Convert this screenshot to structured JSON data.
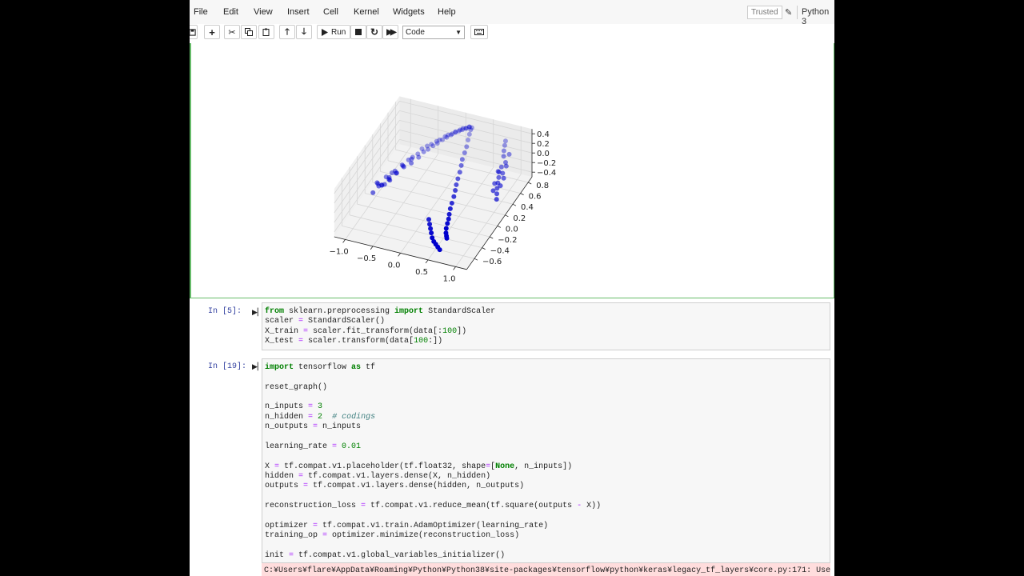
{
  "menubar": {
    "items": [
      "File",
      "Edit",
      "View",
      "Insert",
      "Cell",
      "Kernel",
      "Widgets",
      "Help"
    ],
    "trusted": "Trusted",
    "kernel": "Python 3"
  },
  "toolbar": {
    "run_label": "Run",
    "cell_type": "Code",
    "icons": [
      "save-icon",
      "add-cell-icon",
      "cut-icon",
      "copy-icon",
      "paste-icon",
      "move-up-icon",
      "move-down-icon",
      "run-icon",
      "stop-icon",
      "restart-icon",
      "fast-forward-icon",
      "keyboard-icon"
    ]
  },
  "chart_data": {
    "type": "scatter",
    "projection": "3d",
    "title": "",
    "x_ticks": [
      "−1.0",
      "−0.5",
      "0.0",
      "0.5",
      "1.0"
    ],
    "y_ticks": [
      "−0.6",
      "−0.4",
      "−0.2",
      "0.0",
      "0.2",
      "0.4",
      "0.6",
      "0.8"
    ],
    "z_ticks": [
      "−0.4",
      "−0.2",
      "0.0",
      "0.2",
      "0.4"
    ],
    "xlim": [
      -1.2,
      1.2
    ],
    "ylim": [
      -0.7,
      0.9
    ],
    "zlim": [
      -0.5,
      0.5
    ],
    "color": "#0000cc",
    "grid": true,
    "points": [
      [
        -1.05,
        0.1,
        -0.35
      ],
      [
        -1.0,
        0.05,
        -0.3
      ],
      [
        -0.98,
        0.12,
        -0.4
      ],
      [
        -0.95,
        0.0,
        -0.28
      ],
      [
        -1.02,
        -0.05,
        -0.38
      ],
      [
        -0.92,
        0.15,
        -0.25
      ],
      [
        -0.9,
        0.08,
        -0.32
      ],
      [
        -0.88,
        -0.02,
        -0.22
      ],
      [
        -0.85,
        0.2,
        -0.2
      ],
      [
        -0.83,
        0.1,
        -0.18
      ],
      [
        -0.8,
        0.05,
        -0.15
      ],
      [
        -0.78,
        0.18,
        -0.12
      ],
      [
        -0.75,
        0.0,
        -0.1
      ],
      [
        -0.72,
        0.12,
        -0.08
      ],
      [
        -0.7,
        0.25,
        -0.05
      ],
      [
        -0.68,
        0.08,
        -0.02
      ],
      [
        -0.65,
        0.2,
        0.0
      ],
      [
        -0.62,
        0.3,
        0.02
      ],
      [
        -0.6,
        0.15,
        0.05
      ],
      [
        -0.58,
        0.35,
        0.03
      ],
      [
        -0.55,
        0.28,
        0.08
      ],
      [
        -0.52,
        0.4,
        0.06
      ],
      [
        -0.5,
        0.2,
        0.1
      ],
      [
        -0.48,
        0.45,
        0.12
      ],
      [
        -0.45,
        0.32,
        0.1
      ],
      [
        -0.42,
        0.5,
        0.14
      ],
      [
        -0.4,
        0.38,
        0.16
      ],
      [
        -0.38,
        0.55,
        0.13
      ],
      [
        -0.35,
        0.42,
        0.18
      ],
      [
        -0.32,
        0.6,
        0.15
      ],
      [
        -0.3,
        0.48,
        0.2
      ],
      [
        -0.28,
        0.62,
        0.17
      ],
      [
        -0.25,
        0.52,
        0.22
      ],
      [
        -0.22,
        0.68,
        0.19
      ],
      [
        -0.2,
        0.58,
        0.24
      ],
      [
        -0.18,
        0.7,
        0.21
      ],
      [
        -0.15,
        0.62,
        0.26
      ],
      [
        -0.12,
        0.72,
        0.23
      ],
      [
        -0.1,
        0.66,
        0.28
      ],
      [
        -0.08,
        0.75,
        0.25
      ],
      [
        -0.05,
        0.7,
        0.3
      ],
      [
        -0.02,
        0.78,
        0.27
      ],
      [
        0.0,
        0.72,
        0.32
      ],
      [
        0.02,
        0.8,
        0.29
      ],
      [
        0.05,
        0.74,
        0.34
      ],
      [
        0.08,
        0.8,
        0.31
      ],
      [
        0.1,
        0.76,
        0.36
      ],
      [
        0.12,
        0.82,
        0.33
      ],
      [
        0.15,
        0.78,
        0.38
      ],
      [
        0.18,
        0.8,
        0.35
      ],
      [
        0.2,
        0.74,
        0.38
      ],
      [
        0.22,
        0.68,
        0.36
      ],
      [
        0.25,
        0.6,
        0.34
      ],
      [
        0.28,
        0.52,
        0.3
      ],
      [
        0.3,
        0.44,
        0.27
      ],
      [
        0.32,
        0.35,
        0.24
      ],
      [
        0.35,
        0.28,
        0.2
      ],
      [
        0.38,
        0.2,
        0.16
      ],
      [
        0.4,
        0.12,
        0.12
      ],
      [
        0.42,
        0.05,
        0.08
      ],
      [
        0.45,
        -0.02,
        0.05
      ],
      [
        0.48,
        -0.1,
        0.02
      ],
      [
        0.5,
        -0.18,
        -0.02
      ],
      [
        0.52,
        -0.25,
        -0.05
      ],
      [
        0.55,
        -0.32,
        -0.08
      ],
      [
        0.58,
        -0.38,
        -0.1
      ],
      [
        0.6,
        -0.44,
        -0.12
      ],
      [
        0.62,
        -0.5,
        -0.15
      ],
      [
        0.65,
        -0.55,
        -0.18
      ],
      [
        0.68,
        -0.58,
        -0.2
      ],
      [
        0.7,
        -0.6,
        -0.22
      ],
      [
        0.3,
        -0.45,
        -0.3
      ],
      [
        0.35,
        -0.5,
        -0.32
      ],
      [
        0.4,
        -0.55,
        -0.35
      ],
      [
        0.45,
        -0.58,
        -0.38
      ],
      [
        0.5,
        -0.6,
        -0.4
      ],
      [
        0.25,
        -0.4,
        -0.28
      ],
      [
        0.2,
        -0.35,
        -0.25
      ],
      [
        0.55,
        -0.62,
        -0.42
      ],
      [
        0.6,
        -0.64,
        -0.44
      ],
      [
        0.95,
        0.4,
        0.1
      ],
      [
        0.98,
        0.35,
        0.05
      ],
      [
        1.0,
        0.3,
        0.0
      ],
      [
        1.02,
        0.25,
        -0.05
      ],
      [
        0.96,
        0.45,
        0.15
      ],
      [
        1.05,
        0.2,
        -0.1
      ],
      [
        1.0,
        0.5,
        0.2
      ],
      [
        0.93,
        0.55,
        0.25
      ],
      [
        1.03,
        0.38,
        0.12
      ],
      [
        1.06,
        0.28,
        -0.02
      ],
      [
        0.9,
        0.6,
        0.3
      ],
      [
        0.88,
        0.65,
        0.35
      ],
      [
        1.08,
        0.15,
        -0.15
      ],
      [
        0.92,
        0.42,
        0.08
      ],
      [
        1.04,
        0.46,
        0.18
      ],
      [
        0.97,
        0.22,
        -0.08
      ],
      [
        1.01,
        0.58,
        0.28
      ],
      [
        0.86,
        0.7,
        0.38
      ],
      [
        1.07,
        0.35,
        0.06
      ],
      [
        0.94,
        0.3,
        -0.03
      ]
    ]
  },
  "cells": [
    {
      "prompt": "In [5]:",
      "lines": [
        [
          [
            "kw",
            "from"
          ],
          [
            "",
            " sklearn.preprocessing "
          ],
          [
            "kw",
            "import"
          ],
          [
            "",
            " StandardScaler"
          ]
        ],
        [
          [
            "",
            "scaler "
          ],
          [
            "op",
            "="
          ],
          [
            "",
            " StandardScaler()"
          ]
        ],
        [
          [
            "",
            "X_train "
          ],
          [
            "op",
            "="
          ],
          [
            "",
            " scaler.fit_transform(data[:"
          ],
          [
            "num",
            "100"
          ],
          [
            "",
            "])"
          ]
        ],
        [
          [
            "",
            "X_test "
          ],
          [
            "op",
            "="
          ],
          [
            "",
            " scaler.transform(data["
          ],
          [
            "num",
            "100"
          ],
          [
            "",
            ":])"
          ]
        ]
      ]
    },
    {
      "prompt": "In [19]:",
      "lines": [
        [
          [
            "kw",
            "import"
          ],
          [
            "",
            " tensorflow "
          ],
          [
            "kw",
            "as"
          ],
          [
            "",
            " tf"
          ]
        ],
        [],
        [
          [
            "",
            "reset_graph()"
          ]
        ],
        [],
        [
          [
            "",
            "n_inputs "
          ],
          [
            "op",
            "="
          ],
          [
            "",
            " "
          ],
          [
            "num",
            "3"
          ]
        ],
        [
          [
            "",
            "n_hidden "
          ],
          [
            "op",
            "="
          ],
          [
            "",
            " "
          ],
          [
            "num",
            "2"
          ],
          [
            "",
            "  "
          ],
          [
            "cm",
            "# codings"
          ]
        ],
        [
          [
            "",
            "n_outputs "
          ],
          [
            "op",
            "="
          ],
          [
            "",
            " n_inputs"
          ]
        ],
        [],
        [
          [
            "",
            "learning_rate "
          ],
          [
            "op",
            "="
          ],
          [
            "",
            " "
          ],
          [
            "num",
            "0.01"
          ]
        ],
        [],
        [
          [
            "",
            "X "
          ],
          [
            "op",
            "="
          ],
          [
            "",
            " tf.compat.v1.placeholder(tf.float32, shape"
          ],
          [
            "op",
            "="
          ],
          [
            "",
            "["
          ],
          [
            "bc",
            "None"
          ],
          [
            "",
            ", n_inputs])"
          ]
        ],
        [
          [
            "",
            "hidden "
          ],
          [
            "op",
            "="
          ],
          [
            "",
            " tf.compat.v1.layers.dense(X, n_hidden)"
          ]
        ],
        [
          [
            "",
            "outputs "
          ],
          [
            "op",
            "="
          ],
          [
            "",
            " tf.compat.v1.layers.dense(hidden, n_outputs)"
          ]
        ],
        [],
        [
          [
            "",
            "reconstruction_loss "
          ],
          [
            "op",
            "="
          ],
          [
            "",
            " tf.compat.v1.reduce_mean(tf.square(outputs "
          ],
          [
            "op",
            "-"
          ],
          [
            "",
            " X))"
          ]
        ],
        [],
        [
          [
            "",
            "optimizer "
          ],
          [
            "op",
            "="
          ],
          [
            "",
            " tf.compat.v1.train.AdamOptimizer(learning_rate)"
          ]
        ],
        [
          [
            "",
            "training_op "
          ],
          [
            "op",
            "="
          ],
          [
            "",
            " optimizer.minimize(reconstruction_loss)"
          ]
        ],
        [],
        [
          [
            "",
            "init "
          ],
          [
            "op",
            "="
          ],
          [
            "",
            " tf.compat.v1.global_variables_initializer()"
          ]
        ]
      ]
    }
  ],
  "stderr": "C:¥Users¥flare¥AppData¥Roaming¥Python¥Python38¥site-packages¥tensorflow¥python¥keras¥legacy_tf_layers¥core.py:171: UserWarning: `tf.layer"
}
